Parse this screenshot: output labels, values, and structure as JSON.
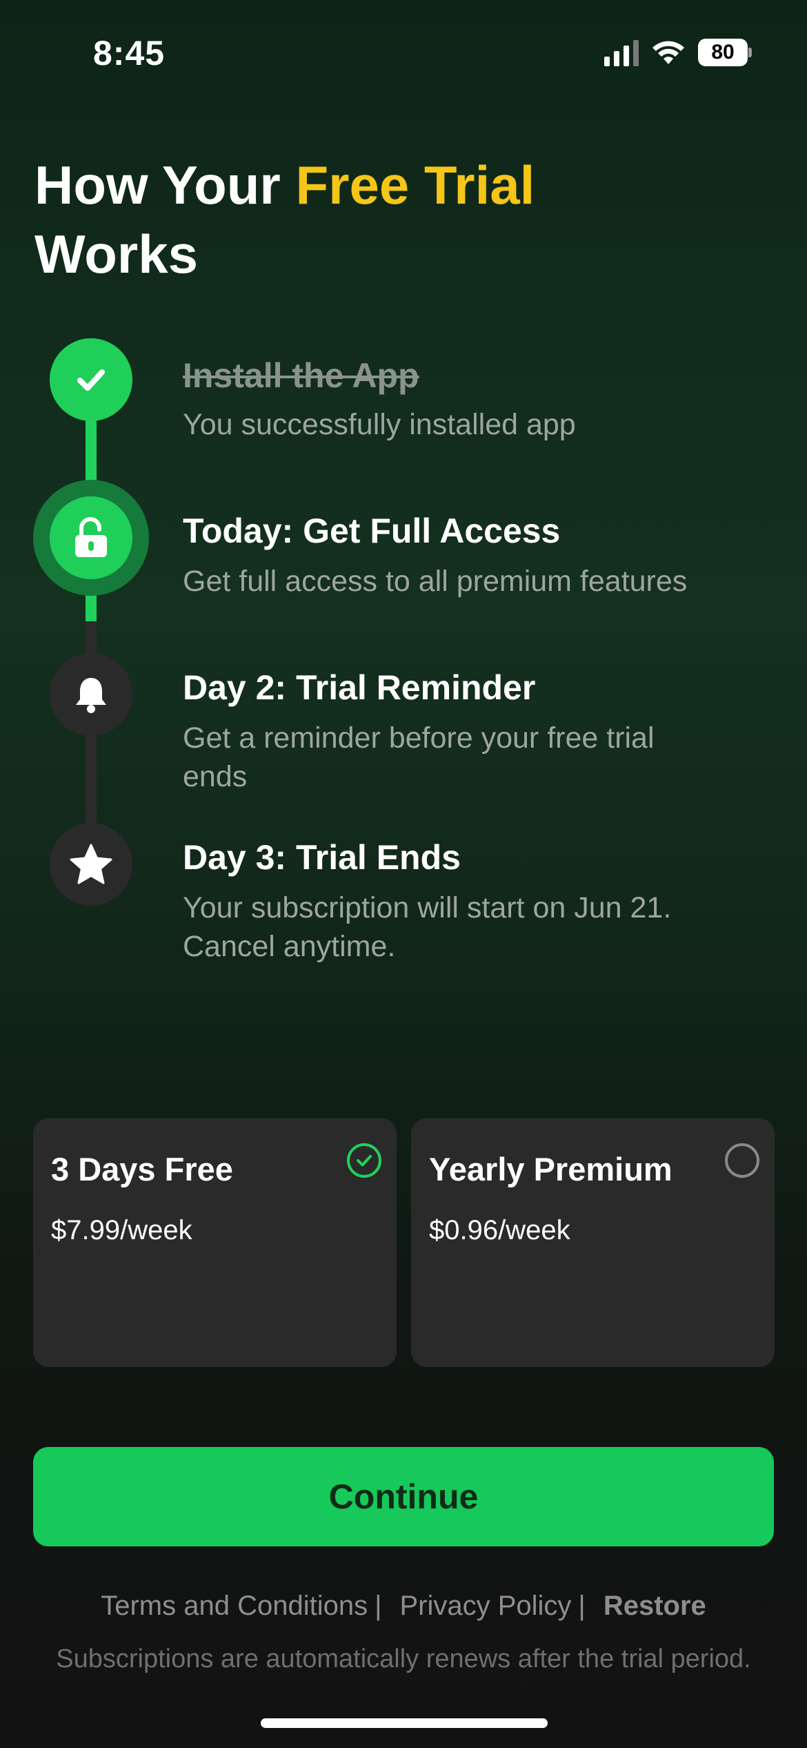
{
  "status_bar": {
    "time": "8:45",
    "battery": "80"
  },
  "header": {
    "title_part1": "How Your ",
    "title_accent": "Free Trial",
    "title_part2": "Works"
  },
  "timeline": {
    "steps": [
      {
        "title": "Install the App",
        "description": "You successfully installed app",
        "state": "done",
        "icon": "check-icon"
      },
      {
        "title": "Today: Get Full Access",
        "description": "Get full access to all premium features",
        "state": "current",
        "icon": "unlock-icon"
      },
      {
        "title": "Day 2: Trial Reminder",
        "description": "Get a reminder before your free trial ends",
        "state": "pending",
        "icon": "bell-icon"
      },
      {
        "title": "Day 3: Trial Ends",
        "description": "Your subscription will start on Jun 21. Cancel anytime.",
        "state": "pending",
        "icon": "star-icon"
      }
    ]
  },
  "plans": [
    {
      "name": "3 Days Free",
      "price": "$7.99/week",
      "selected": true
    },
    {
      "name": "Yearly Premium",
      "price": "$0.96/week",
      "selected": false
    }
  ],
  "continue_label": "Continue",
  "footer": {
    "terms": "Terms and Conditions",
    "privacy": "Privacy Policy",
    "restore": "Restore",
    "separator": "|",
    "note": "Subscriptions are automatically renews after the trial period."
  },
  "colors": {
    "accent_yellow": "#f5c518",
    "brand_green": "#1fd35b",
    "button_green": "#16c95a"
  }
}
